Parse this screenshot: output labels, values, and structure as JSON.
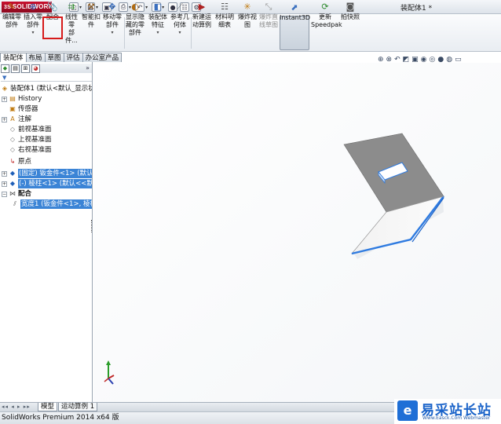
{
  "app": {
    "brand": "SOLIDWORKS",
    "window_title": "装配体1 *",
    "status_text": "SolidWorks Premium 2014 x64 版"
  },
  "toolbar": {
    "items": [
      {
        "label1": "编辑零",
        "label2": "部件",
        "icon": "edit-component-icon"
      },
      {
        "label1": "插入零",
        "label2": "部件",
        "icon": "insert-component-icon"
      },
      {
        "label1": "配合",
        "label2": "",
        "icon": "mate-icon"
      },
      {
        "label1": "线性零",
        "label2": "部件...",
        "icon": "linear-pattern-icon"
      },
      {
        "label1": "智能扣",
        "label2": "件",
        "icon": "smart-fastener-icon"
      },
      {
        "label1": "移动零",
        "label2": "部件",
        "icon": "move-component-icon"
      },
      {
        "label1": "显示隐",
        "label2": "藏的零",
        "label3": "部件",
        "icon": "show-hidden-icon"
      },
      {
        "label1": "装配体",
        "label2": "特征",
        "icon": "assembly-feature-icon"
      },
      {
        "label1": "参考几",
        "label2": "何体",
        "icon": "reference-geometry-icon"
      },
      {
        "label1": "新建运",
        "label2": "动算例",
        "icon": "new-motion-study-icon"
      },
      {
        "label1": "材料明",
        "label2": "细表",
        "icon": "bom-icon"
      },
      {
        "label1": "爆炸视",
        "label2": "图",
        "icon": "exploded-view-icon"
      },
      {
        "label1": "爆炸直",
        "label2": "线草图",
        "icon": "explode-line-icon"
      },
      {
        "label1": "Instant3D",
        "label2": "",
        "icon": "instant3d-icon"
      },
      {
        "label1": "更新",
        "label2": "Speedpak",
        "icon": "speedpak-icon"
      },
      {
        "label1": "拍快照",
        "label2": "",
        "icon": "snapshot-icon"
      }
    ]
  },
  "command_tabs": [
    "装配体",
    "布局",
    "草图",
    "评估",
    "办公室产品"
  ],
  "tree": {
    "root": "装配体1 (默认<默认_显示状态",
    "items": [
      {
        "label": "History",
        "icon": "history-icon"
      },
      {
        "label": "传感器",
        "icon": "sensor-icon"
      },
      {
        "label": "注解",
        "icon": "annotation-icon"
      },
      {
        "label": "前视基准面",
        "icon": "plane-icon"
      },
      {
        "label": "上视基准面",
        "icon": "plane-icon"
      },
      {
        "label": "右视基准面",
        "icon": "plane-icon"
      },
      {
        "label": "原点",
        "icon": "origin-icon"
      },
      {
        "label": "(固定) 钣金件<1> (默认<<",
        "icon": "part-icon"
      },
      {
        "label": "(-) 棱柱<1> (默认<<默认>",
        "icon": "part-icon"
      },
      {
        "label": "配合",
        "icon": "mates-folder-icon"
      },
      {
        "label": "宽度1 (钣金件<1>, 棱柱",
        "icon": "width-mate-icon"
      }
    ]
  },
  "bottom_tabs": [
    "模型",
    "运动算例 1"
  ],
  "watermark": {
    "text": "易采站长站",
    "url": "Www.Easck.Com Webmaster"
  },
  "colors": {
    "selection": "#3b84d6",
    "highlight_box": "#d61a1a",
    "part_gray": "#8c8c8c",
    "edge_blue": "#2f7be0"
  }
}
